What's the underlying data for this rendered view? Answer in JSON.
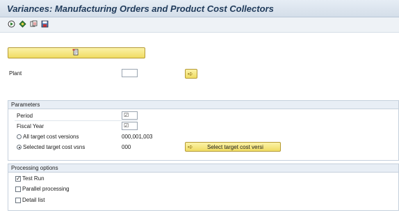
{
  "window": {
    "title": "Variances: Manufacturing Orders and Product Cost Collectors"
  },
  "toolbar": {
    "icons": [
      "execute-icon",
      "variant-icon",
      "copy-icon",
      "save-icon"
    ]
  },
  "main": {
    "plant_label": "Plant",
    "plant_value": ""
  },
  "parameters": {
    "header": "Parameters",
    "period_label": "Period",
    "period_check": "☑",
    "fiscal_year_label": "Fiscal Year",
    "fiscal_year_check": "☑",
    "all_versions_label": "All target cost versions",
    "all_versions_value": "000,001,003",
    "selected_vsns_label": "Selected target cost vsns",
    "selected_vsns_value": "000",
    "select_button_label": "Select target cost versi"
  },
  "processing": {
    "header": "Processing options",
    "test_run_label": "Test Run",
    "parallel_label": "Parallel processing",
    "detail_label": "Detail list"
  },
  "colors": {
    "button_yellow": "#f0dc63",
    "header_blue": "#1f3a5a",
    "group_header": "#e8eef5"
  }
}
